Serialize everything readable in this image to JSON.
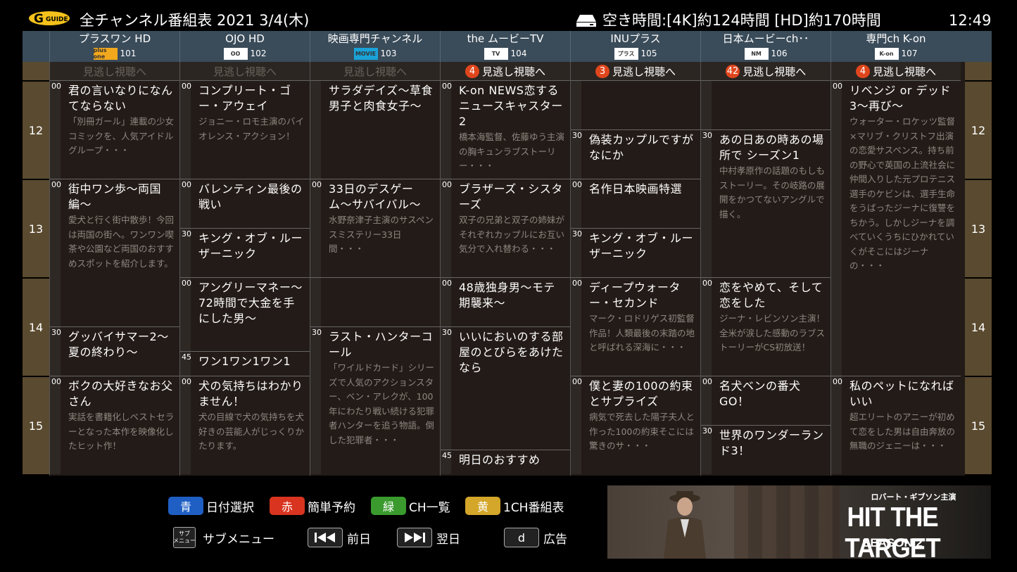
{
  "header": {
    "title": "全チャンネル番組表 2021 3/4(木)",
    "recording_remaining": "空き時間:[4K]約124時間 [HD]約170時間",
    "clock": "12:49",
    "logo_text": "GUIDE"
  },
  "hours": [
    "12",
    "13",
    "14",
    "15"
  ],
  "channels": [
    {
      "name": "プラスワン HD",
      "logo_text": "plus one",
      "logo_color": "#f2a81d",
      "number": "101",
      "catchup": {
        "badge": "",
        "label": "見逃し視聴へ",
        "active": false
      },
      "programs": [
        {
          "min": "00",
          "title": "君の言いなりになんてならない",
          "desc": "「別冊ガール」連載の少女コミックを、人気アイドルグループ・・・",
          "start": 0,
          "end": 60
        },
        {
          "min": "00",
          "title": "街中ワン歩〜両国編〜",
          "desc": "愛犬と行く街中散歩！今回は両国の街へ。ワンワン喫茶や公園など両国のおすすめスポットを紹介します。",
          "start": 60,
          "end": 150
        },
        {
          "min": "30",
          "title": "グッバイサマー2〜夏の終わり〜",
          "desc": "",
          "start": 150,
          "end": 180
        },
        {
          "min": "00",
          "title": "ボクの大好きなお父さん",
          "desc": "実話を書籍化しベストセラーとなった本作を映像化したヒット作！",
          "start": 180,
          "end": 240
        }
      ]
    },
    {
      "name": "OJO HD",
      "logo_text": "OO",
      "logo_color": "#ffffff",
      "number": "102",
      "catchup": {
        "badge": "",
        "label": "見逃し視聴へ",
        "active": false
      },
      "programs": [
        {
          "min": "00",
          "title": "コンプリート・ゴー・アウェイ",
          "desc": "ジョニー・ロモ主演のバイオレンス・アクション！",
          "start": 0,
          "end": 60
        },
        {
          "min": "00",
          "title": "バレンティン最後の戦い",
          "desc": "",
          "start": 60,
          "end": 90
        },
        {
          "min": "30",
          "title": "キング・オブ・ルーザーニック",
          "desc": "",
          "start": 90,
          "end": 120
        },
        {
          "min": "00",
          "title": "アングリーマネー〜72時間で大金を手にした男〜",
          "desc": "",
          "start": 120,
          "end": 165
        },
        {
          "min": "45",
          "title": "ワン1ワン1ワン1",
          "desc": "",
          "start": 165,
          "end": 180
        },
        {
          "min": "00",
          "title": "犬の気持ちはわかりません！",
          "desc": "犬の目線で犬の気持ちを犬好きの芸能人がじっくりかたります。",
          "start": 180,
          "end": 240
        }
      ]
    },
    {
      "name": "映画専門チャンネル",
      "logo_text": "MOVIE",
      "logo_color": "#1aa3d9",
      "number": "103",
      "catchup": {
        "badge": "",
        "label": "見逃し視聴へ",
        "active": false
      },
      "programs": [
        {
          "min": "",
          "title": "サラダデイズ〜草食男子と肉食女子〜",
          "desc": "",
          "start": 0,
          "end": 60
        },
        {
          "min": "00",
          "title": "33日のデスゲーム〜サバイバル〜",
          "desc": "水野奈津子主演のサスペンスミステリー33日間・・・",
          "start": 60,
          "end": 120
        },
        {
          "min": "",
          "title": "",
          "desc": "",
          "start": 120,
          "end": 150
        },
        {
          "min": "30",
          "title": "ラスト・ハンターコール",
          "desc": "「ワイルドカード」シリーズで人気のアクションスター、ベン・アレクが、100年にわたり戦い続ける犯罪者ハンターを追う物語。倒した犯罪者・・・",
          "start": 150,
          "end": 240
        }
      ]
    },
    {
      "name": "the ムービーTV",
      "logo_text": "TV",
      "logo_color": "#ffffff",
      "number": "104",
      "catchup": {
        "badge": "4",
        "label": "見逃し視聴へ",
        "active": true
      },
      "programs": [
        {
          "min": "00",
          "title": "K-on NEWS恋するニュースキャスター2",
          "desc": "橋本海監督、佐藤ゆう主演の胸キュンラブストーリー・・・",
          "start": 0,
          "end": 60
        },
        {
          "min": "00",
          "title": "ブラザーズ・シスターズ",
          "desc": "双子の兄弟と双子の姉妹がそれぞれカップルにお互い気分で入れ替わる・・・",
          "start": 60,
          "end": 120
        },
        {
          "min": "00",
          "title": "48歳独身男〜モテ期襲来〜",
          "desc": "",
          "start": 120,
          "end": 150
        },
        {
          "min": "30",
          "title": "いいにおいのする部屋のとびらをあけたなら",
          "desc": "",
          "start": 150,
          "end": 225
        },
        {
          "min": "45",
          "title": "明日のおすすめ",
          "desc": "",
          "start": 225,
          "end": 240
        }
      ]
    },
    {
      "name": "INUプラス",
      "logo_text": "プラス",
      "logo_color": "#ffffff",
      "number": "105",
      "catchup": {
        "badge": "3",
        "label": "見逃し視聴へ",
        "active": true
      },
      "programs": [
        {
          "min": "",
          "title": "",
          "desc": "",
          "start": 0,
          "end": 30
        },
        {
          "min": "30",
          "title": "偽装カップルですがなにか",
          "desc": "",
          "start": 30,
          "end": 60
        },
        {
          "min": "00",
          "title": "名作日本映画特選",
          "desc": "",
          "start": 60,
          "end": 90
        },
        {
          "min": "30",
          "title": "キング・オブ・ルーザーニック",
          "desc": "",
          "start": 90,
          "end": 120
        },
        {
          "min": "00",
          "title": "ディープウォーター・セカンド",
          "desc": "マーク・ロドリゲス初監督作品！人類最後の末踏の地と呼ばれる深海に・・・",
          "start": 120,
          "end": 180
        },
        {
          "min": "00",
          "title": "僕と妻の100の約束とサプライズ",
          "desc": "病気で死去した陽子夫人と作った100の約束そこには驚きのサ・・・",
          "start": 180,
          "end": 240
        }
      ]
    },
    {
      "name": "日本ムービーch･･",
      "logo_text": "NM",
      "logo_color": "#ffffff",
      "number": "106",
      "catchup": {
        "badge": "42",
        "label": "見逃し視聴へ",
        "active": true
      },
      "programs": [
        {
          "min": "",
          "title": "",
          "desc": "",
          "start": 0,
          "end": 30
        },
        {
          "min": "30",
          "title": "あの日あの時あの場所で シーズン1",
          "desc": "中村孝原作の話題のもしもストーリー。その岐路の展開をかつてないアングルで描く。",
          "start": 30,
          "end": 120
        },
        {
          "min": "00",
          "title": "恋をやめて、そして恋をした",
          "desc": "ジーナ・レビンソン主演！全米が涙した感動のラブストーリーがCS初放送！",
          "start": 120,
          "end": 180
        },
        {
          "min": "00",
          "title": "名犬ベンの番犬GO！",
          "desc": "",
          "start": 180,
          "end": 210
        },
        {
          "min": "30",
          "title": "世界のワンダーランド3！",
          "desc": "",
          "start": 210,
          "end": 240
        }
      ]
    },
    {
      "name": "専門ch K-on",
      "logo_text": "K-on",
      "logo_color": "#ffffff",
      "number": "107",
      "catchup": {
        "badge": "4",
        "label": "見逃し視聴へ",
        "active": true
      },
      "programs": [
        {
          "min": "00",
          "title": "リベンジ or デッド3〜再び〜",
          "desc": "ウォーター・ロケッツ監督×マリブ・クリストフ出演の恋愛サスペンス。持ち前の野心で英国の上流社会に仲間入りした元プロテニス選手のケビンは、選手生命をうばったジーナに復讐をちかう。しかしジーナを調べていくうちにひかれていくがそこにはジーナの・・・",
          "start": 0,
          "end": 180
        },
        {
          "min": "00",
          "title": "私のペットになればいい",
          "desc": "超エリートのアニーが初めて恋をした男は自由奔放の無職のジェニーは・・・",
          "start": 180,
          "end": 240
        }
      ]
    }
  ],
  "legend": {
    "blue": {
      "chip": "青",
      "label": "日付選択",
      "color": "#1f5fc4"
    },
    "red": {
      "chip": "赤",
      "label": "簡単予約",
      "color": "#d8341f"
    },
    "green": {
      "chip": "緑",
      "label": "CH一覧",
      "color": "#3a9a2e"
    },
    "yellow": {
      "chip": "黄",
      "label": "1CH番組表",
      "color": "#d4a62a"
    },
    "submenu": {
      "chip_line1": "サブ",
      "chip_line2": "メニュー",
      "label": "サブメニュー"
    },
    "prev": {
      "label": "前日"
    },
    "next": {
      "label": "翌日"
    },
    "ad": {
      "chip": "d",
      "label": "広告"
    }
  },
  "ad_banner": {
    "subtitle": "ロバート・ギブソン主演",
    "title": "HIT THE TARGET",
    "season": "SEASON 2"
  }
}
